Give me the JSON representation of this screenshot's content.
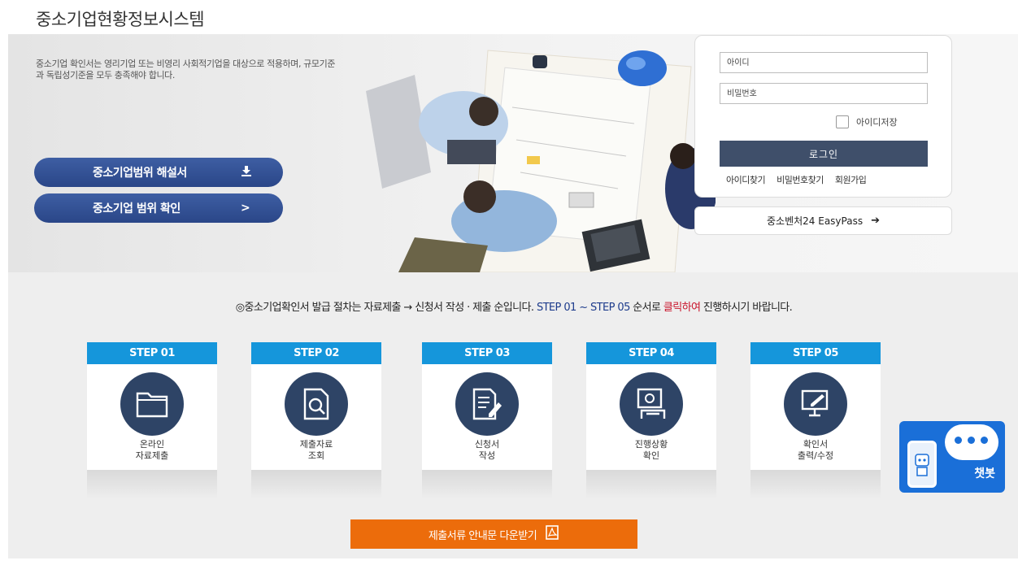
{
  "header": {
    "title": "중소기업현황정보시스템"
  },
  "hero": {
    "intro": "중소기업 확인서는 영리기업 또는 비영리 사회적기업을 대상으로 적용하며, 규모기준과 독립성기준을 모두 충족해야 합니다.",
    "buttons": [
      {
        "label": "중소기업범위 해설서",
        "icon": "download-icon",
        "icon_glyph": "⬇"
      },
      {
        "label": "중소기업 범위 확인",
        "icon": "chevron-right-icon",
        "icon_glyph": ">"
      }
    ],
    "accent": "#2a4688"
  },
  "login": {
    "id_placeholder": "아이디",
    "pw_placeholder": "비밀번호",
    "remember_label": "아이디저장",
    "login_label": "로그인",
    "links": [
      "아이디찾기",
      "비밀번호찾기",
      "회원가입"
    ],
    "button_color": "#3f4f6a"
  },
  "easypass": {
    "label": "중소벤처24 EasyPass",
    "arrow": "➔"
  },
  "notice": {
    "part1": "◎중소기업확인서 발급 절차는 자료제출 → 신청서 작성 · 제출 순입니다. ",
    "part2": "STEP 01 ~ STEP 05",
    "part3": " 순서로 ",
    "part4": "클릭하여",
    "part5": " 진행하시기 바랍니다."
  },
  "steps": [
    {
      "tab": "STEP 01",
      "line1": "온라인",
      "line2": "자료제출",
      "icon": "folder-icon"
    },
    {
      "tab": "STEP 02",
      "line1": "제출자료",
      "line2": "조회",
      "icon": "document-search-icon"
    },
    {
      "tab": "STEP 03",
      "line1": "신청서",
      "line2": "작성",
      "icon": "document-edit-icon"
    },
    {
      "tab": "STEP 04",
      "line1": "진행상황",
      "line2": "확인",
      "icon": "progress-check-icon"
    },
    {
      "tab": "STEP 05",
      "line1": "확인서",
      "line2": "출력/수정",
      "icon": "print-edit-icon"
    }
  ],
  "step_colors": {
    "tab": "#1596db",
    "circle": "#2e4466"
  },
  "download": {
    "label": "제출서류 안내문 다운받기",
    "icon": "pdf-icon",
    "color": "#ec6c0b"
  },
  "chatbot": {
    "label": "챗봇",
    "color": "#1a6fd8"
  }
}
